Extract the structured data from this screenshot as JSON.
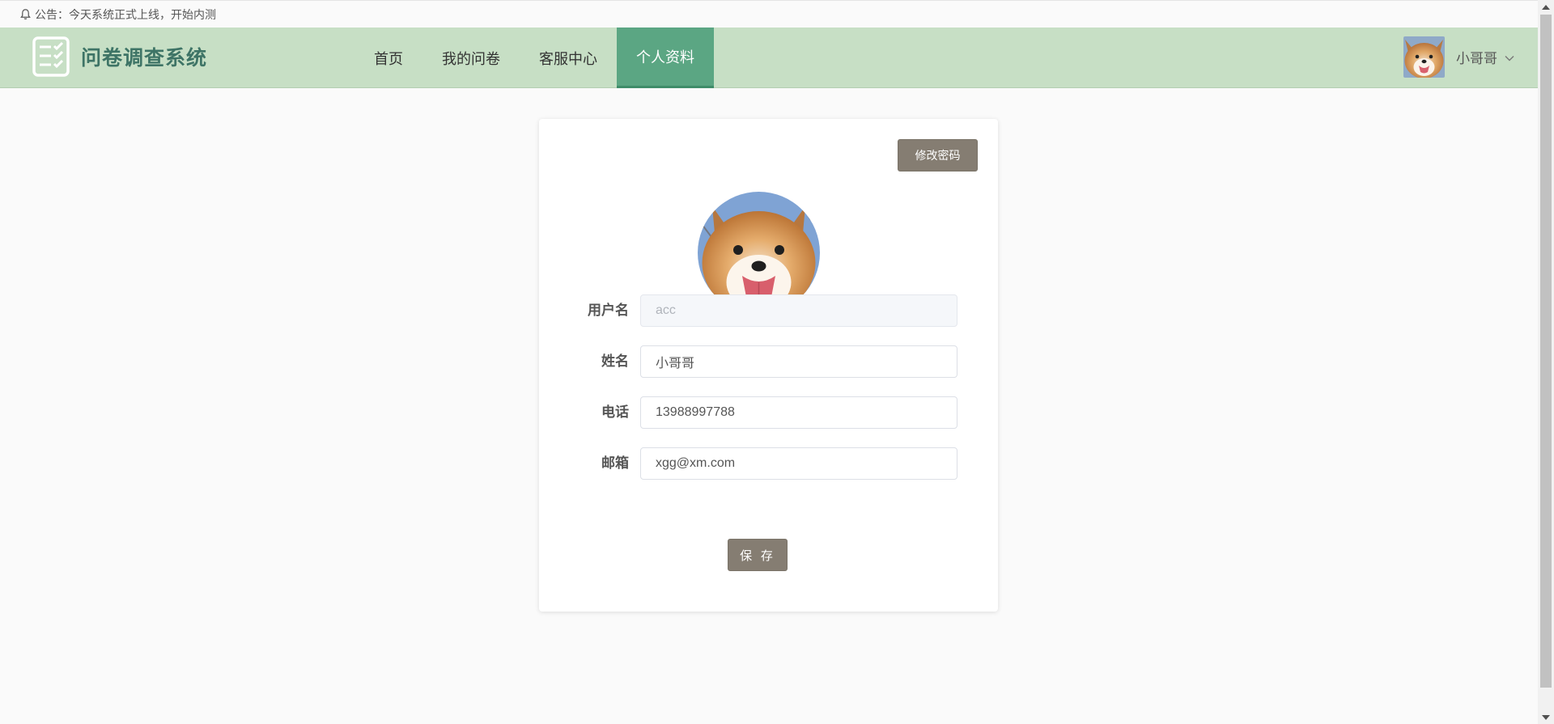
{
  "notice": {
    "text": "公告：今天系统正式上线，开始内测",
    "icon": "bell-icon"
  },
  "header": {
    "logo_text": "问卷调查系统",
    "nav": [
      {
        "label": "首页",
        "active": false
      },
      {
        "label": "我的问卷",
        "active": false
      },
      {
        "label": "客服中心",
        "active": false
      },
      {
        "label": "个人资料",
        "active": true
      }
    ],
    "user": {
      "name": "小哥哥",
      "avatar": "dog-avatar"
    }
  },
  "profile": {
    "change_password_label": "修改密码",
    "fields": [
      {
        "label": "用户名",
        "value": "acc",
        "disabled": true
      },
      {
        "label": "姓名",
        "value": "小哥哥",
        "disabled": false
      },
      {
        "label": "电话",
        "value": "13988997788",
        "disabled": false
      },
      {
        "label": "邮箱",
        "value": "xgg@xm.com",
        "disabled": false
      }
    ],
    "save_label": "保 存"
  },
  "colors": {
    "header_bg": "#c7dfc5",
    "nav_active": "#5ba683",
    "logo_text": "#3e7466",
    "button": "#857d72"
  }
}
